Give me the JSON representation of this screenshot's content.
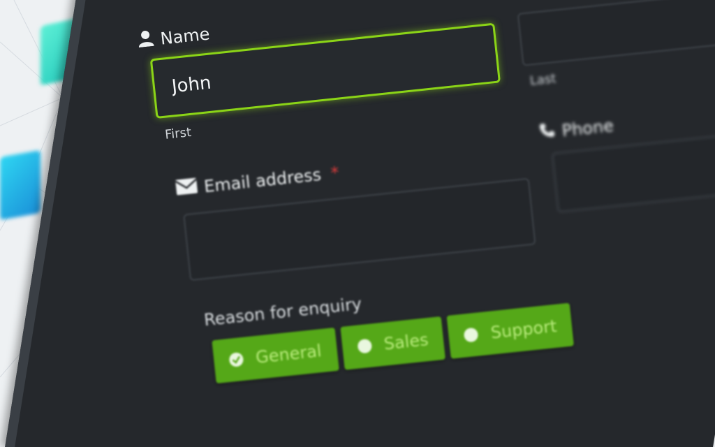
{
  "form": {
    "name": {
      "label": "Name",
      "value": "John",
      "first_label": "First",
      "last_label": "Last"
    },
    "email": {
      "label": "Email address",
      "required_mark": "*",
      "value": ""
    },
    "phone": {
      "label": "Phone",
      "value": ""
    },
    "reason": {
      "label": "Reason for enquiry",
      "options": [
        {
          "label": "General",
          "selected": true
        },
        {
          "label": "Sales",
          "selected": false
        },
        {
          "label": "Support",
          "selected": false
        }
      ]
    }
  },
  "colors": {
    "accent": "#8bd417",
    "button": "#55a818",
    "panel": "#25282c"
  },
  "icons": {
    "name": "user-icon",
    "email": "envelope-icon",
    "phone": "phone-icon",
    "selected": "check-icon"
  }
}
